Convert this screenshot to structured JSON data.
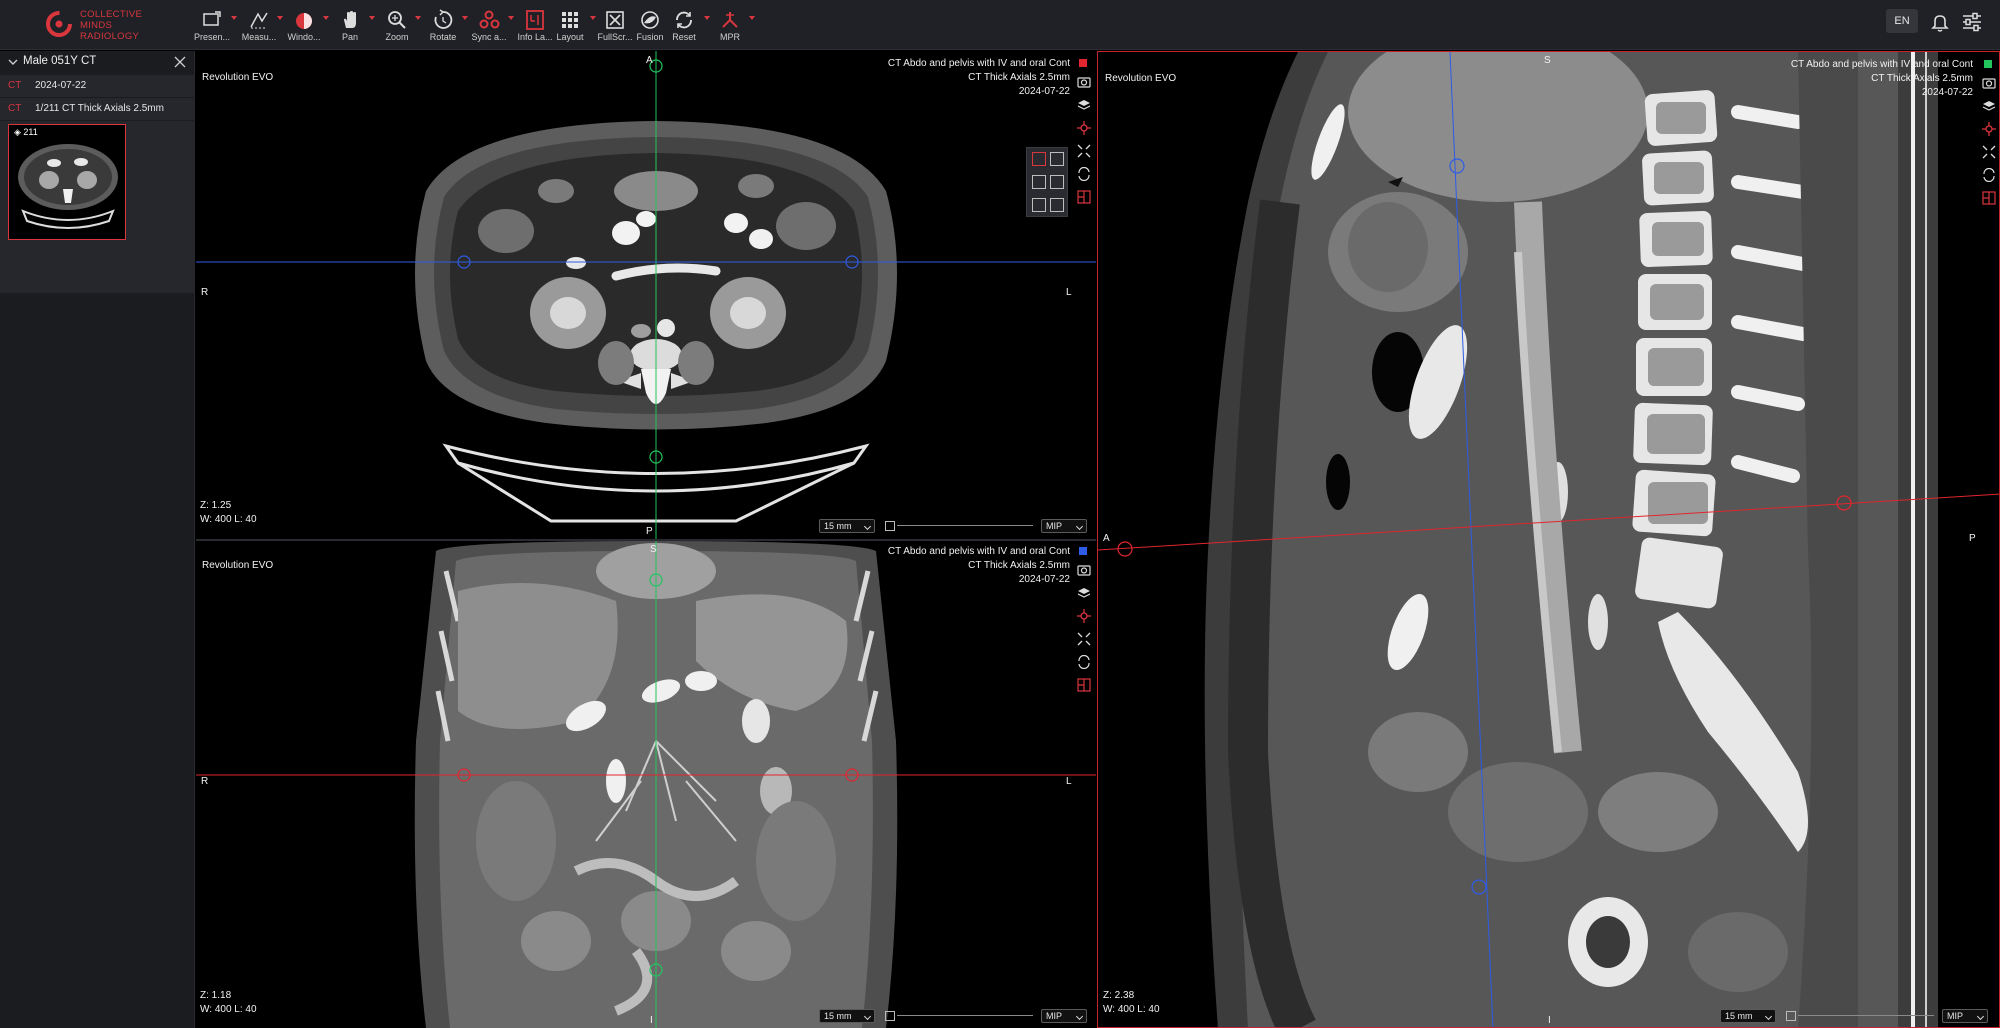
{
  "brand": {
    "lines": [
      "COLLECTIVE",
      "MINDS",
      "RADIOLOGY"
    ],
    "accent": "#d9363e"
  },
  "toolbar": {
    "tools": [
      {
        "label": "Presen...",
        "icon": "presentation-icon"
      },
      {
        "label": "Measu...",
        "icon": "measure-icon"
      },
      {
        "label": "Windo...",
        "icon": "window-level-icon"
      },
      {
        "label": "Pan",
        "icon": "hand-icon"
      },
      {
        "label": "Zoom",
        "icon": "zoom-icon"
      },
      {
        "label": "Rotate",
        "icon": "rotate-icon"
      },
      {
        "label": "Sync a...",
        "icon": "sync-icon"
      },
      {
        "label": "Info La...",
        "icon": "info-layer-icon"
      },
      {
        "label": "Layout",
        "icon": "grid-icon"
      },
      {
        "label": "FullScr...",
        "icon": "fullscreen-icon"
      },
      {
        "label": "Fusion",
        "icon": "fusion-icon"
      },
      {
        "label": "Reset",
        "icon": "reset-icon"
      },
      {
        "label": "MPR",
        "icon": "mpr-icon"
      }
    ],
    "language": "EN"
  },
  "sidebar": {
    "study_title": "Male 051Y CT",
    "rows": [
      {
        "modality": "CT",
        "text": "2024-07-22"
      },
      {
        "modality": "CT",
        "text": "1/211 CT Thick Axials 2.5mm"
      }
    ],
    "thumbnail_count": "211"
  },
  "viewports": {
    "axial": {
      "device": "Revolution EVO",
      "desc": "CT Abdo and pelvis with IV and oral Cont",
      "series": "CT Thick Axials 2.5mm",
      "date": "2024-07-22",
      "zoom": "Z: 1.25",
      "wl": "W: 400 L: 40",
      "orient": {
        "top": "A",
        "bottom": "P",
        "left": "R",
        "right": "L"
      },
      "thickness": "15 mm",
      "mode": "MIP",
      "color": "#e0262e"
    },
    "coronal": {
      "device": "Revolution EVO",
      "desc": "CT Abdo and pelvis with IV and oral Cont",
      "series": "CT Thick Axials 2.5mm",
      "date": "2024-07-22",
      "zoom": "Z: 1.18",
      "wl": "W: 400 L: 40",
      "orient": {
        "top": "S",
        "bottom": "I",
        "left": "R",
        "right": "L"
      },
      "thickness": "15 mm",
      "mode": "MIP",
      "color": "#2e5ce6"
    },
    "sagittal": {
      "device": "Revolution EVO",
      "desc": "CT Abdo and pelvis with IV and oral Cont",
      "series": "CT Thick Axials 2.5mm",
      "date": "2024-07-22",
      "zoom": "Z: 2.38",
      "wl": "W: 400 L: 40",
      "orient": {
        "top": "S",
        "bottom": "I",
        "left": "A",
        "right": "P"
      },
      "thickness": "15 mm",
      "mode": "MIP",
      "color": "#22c55e"
    }
  },
  "tool_icons": [
    "camera-icon",
    "layers-icon",
    "crosshair-icon",
    "collapse-icon",
    "reset-view-icon",
    "split-view-icon"
  ],
  "reset_label": "RESET"
}
